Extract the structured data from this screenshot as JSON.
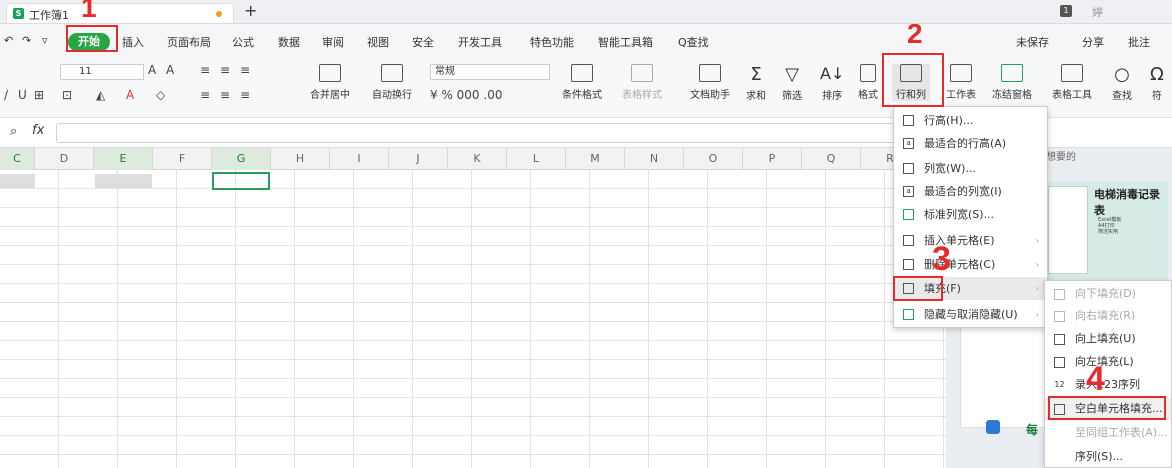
{
  "titlebar": {
    "doc_title": "工作簿1",
    "logo": "S",
    "new_tab": "+",
    "window_badge": "1",
    "user": "婷"
  },
  "menu": {
    "items": [
      "开始",
      "插入",
      "页面布局",
      "公式",
      "数据",
      "审阅",
      "视图",
      "安全",
      "开发工具",
      "特色功能",
      "智能工具箱",
      "Q查找"
    ],
    "unsaved": "未保存",
    "share": "分享",
    "comment": "批注"
  },
  "ribbon": {
    "font_size": "11",
    "number_format": "常规",
    "merge": "合并居中",
    "wrap": "自动换行",
    "cond_format": "条件格式",
    "table_style": "表格样式",
    "doc_helper": "文档助手",
    "sum": "求和",
    "filter": "筛选",
    "sort": "排序",
    "format": "格式",
    "row_col": "行和列",
    "worksheet": "工作表",
    "freeze": "冻结窗格",
    "table_tools": "表格工具",
    "find": "查找",
    "symbol": "符"
  },
  "fx": {
    "label": "fx"
  },
  "columns": [
    "C",
    "D",
    "E",
    "F",
    "G",
    "H",
    "I",
    "J",
    "K",
    "L",
    "M",
    "N",
    "O",
    "P",
    "Q",
    "R"
  ],
  "dropdown": {
    "items": [
      {
        "icon": "row-height-icon",
        "label": "行高(H)..."
      },
      {
        "icon": "autofit-row-icon",
        "label": "最适合的行高(A)"
      },
      {
        "icon": "col-width-icon",
        "label": "列宽(W)..."
      },
      {
        "icon": "autofit-col-icon",
        "label": "最适合的列宽(I)"
      },
      {
        "icon": "std-width-icon",
        "label": "标准列宽(S)..."
      },
      {
        "icon": "insert-cell-icon",
        "label": "插入单元格(E)",
        "sub": true
      },
      {
        "icon": "delete-cell-icon",
        "label": "删除单元格(C)",
        "sub": true
      },
      {
        "icon": "fill-icon",
        "label": "填充(F)",
        "sub": true
      },
      {
        "icon": "hide-icon",
        "label": "隐藏与取消隐藏(U)",
        "sub": true
      }
    ]
  },
  "submenu": {
    "items": [
      {
        "label": "向下填充(D)",
        "disabled": true
      },
      {
        "label": "向右填充(R)",
        "disabled": true
      },
      {
        "label": "向上填充(U)",
        "disabled": false
      },
      {
        "label": "向左填充(L)",
        "disabled": false
      },
      {
        "label": "录入123序列",
        "disabled": false
      },
      {
        "label": "空白单元格填充...",
        "disabled": false
      },
      {
        "label": "至同组工作表(A)...",
        "disabled": true
      },
      {
        "label": "序列(S)...",
        "disabled": false
      }
    ]
  },
  "sidepanel": {
    "search_hint": "想要的",
    "card_title": "电梯消毒记录表",
    "card_lines": [
      "Excel模板",
      "A4打印",
      "简洁实用"
    ],
    "bottom_label": "每"
  },
  "annotations": [
    "1",
    "2",
    "3",
    "4"
  ],
  "colors": {
    "accent_green": "#27a744",
    "annotation_red": "#e52b2b"
  }
}
